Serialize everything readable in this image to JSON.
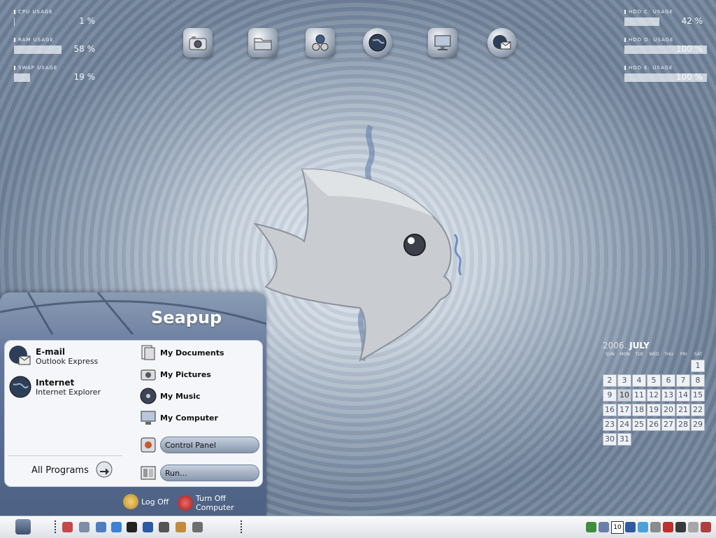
{
  "monitors_left": [
    {
      "label": "CPU USAGE",
      "value": "1 %",
      "percent": 1
    },
    {
      "label": "RAM USAGE",
      "value": "58 %",
      "percent": 58
    },
    {
      "label": "SWAP USAGE",
      "value": "19 %",
      "percent": 19
    }
  ],
  "monitors_right": [
    {
      "label": "HDD C: USAGE",
      "value": "42 %",
      "percent": 42
    },
    {
      "label": "HDD D: USAGE",
      "value": "100 %",
      "percent": 100
    },
    {
      "label": "HDD E: USAGE",
      "value": "100 %",
      "percent": 100
    }
  ],
  "desktop_icons": [
    "camera-icon",
    "folder-icon",
    "network-places-icon",
    "globe-icon",
    "monitor-icon",
    "email-globe-icon"
  ],
  "calendar": {
    "year": "2006.",
    "month": "JULY",
    "weekdays": [
      "SUN",
      "MON",
      "TUE",
      "WED",
      "THU",
      "FRI",
      "SAT"
    ],
    "days": [
      "1",
      "2",
      "3",
      "4",
      "5",
      "6",
      "7",
      "8",
      "9",
      "10",
      "11",
      "12",
      "13",
      "14",
      "15",
      "16",
      "17",
      "18",
      "19",
      "20",
      "21",
      "22",
      "23",
      "24",
      "25",
      "26",
      "27",
      "28",
      "29",
      "30",
      "31"
    ],
    "today": "10"
  },
  "start_menu": {
    "title": "Seapup",
    "pinned": [
      {
        "title": "E-mail",
        "subtitle": "Outlook Express"
      },
      {
        "title": "Internet",
        "subtitle": "Internet Explorer"
      }
    ],
    "all_programs": "All Programs",
    "right_items": [
      "My Documents",
      "My Pictures",
      "My Music",
      "My Computer"
    ],
    "control_panel": "Control Panel",
    "run": "Run...",
    "log_off": "Log Off",
    "turn_off": "Turn Off Computer"
  },
  "colors": {
    "accent": "#4d6184",
    "taskbar": "#e8ecf0"
  }
}
